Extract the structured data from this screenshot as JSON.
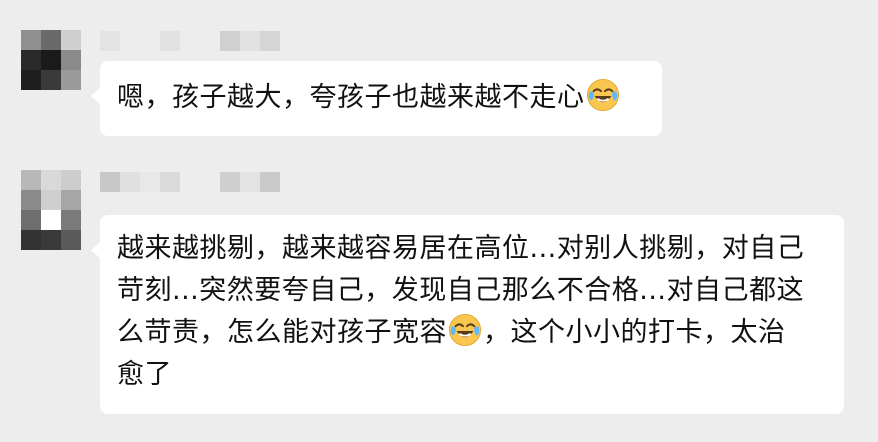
{
  "messages": [
    {
      "sender_name": "",
      "lines": [
        {
          "text": "嗯，孩子越大，夸孩子也越来越不走心",
          "emoji_after": "face-with-tears-of-joy"
        }
      ]
    },
    {
      "sender_name": "",
      "lines": [
        {
          "text": "越来越挑剔，越来越容易居在高位...对别人挑剔，对自己",
          "emoji_after": null
        },
        {
          "text": "苛刻...突然要夸自己，发现自己那么不合格...对自己都这",
          "emoji_after": null
        },
        {
          "text_before": "么苛责，怎么能对孩子宽容",
          "emoji": "face-with-tears-of-joy",
          "text_after": "，这个小小的打卡，太治"
        },
        {
          "text": "愈了",
          "emoji_after": null
        }
      ]
    }
  ],
  "colors": {
    "background": "#ededed",
    "bubble": "#ffffff",
    "text": "#111111"
  }
}
